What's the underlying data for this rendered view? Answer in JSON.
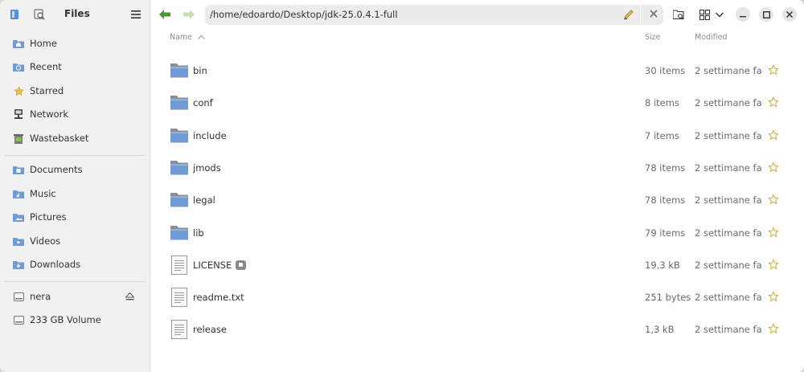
{
  "app": {
    "title": "Files"
  },
  "sidebar": {
    "places": [
      {
        "label": "Home",
        "icon": "home-folder-icon"
      },
      {
        "label": "Recent",
        "icon": "recent-folder-icon"
      },
      {
        "label": "Starred",
        "icon": "star-icon"
      },
      {
        "label": "Network",
        "icon": "network-icon"
      },
      {
        "label": "Wastebasket",
        "icon": "trash-icon"
      }
    ],
    "bookmarks": [
      {
        "label": "Documents",
        "icon": "documents-folder-icon"
      },
      {
        "label": "Music",
        "icon": "music-folder-icon"
      },
      {
        "label": "Pictures",
        "icon": "pictures-folder-icon"
      },
      {
        "label": "Videos",
        "icon": "videos-folder-icon"
      },
      {
        "label": "Downloads",
        "icon": "downloads-folder-icon"
      }
    ],
    "devices": [
      {
        "label": "nera",
        "icon": "drive-icon",
        "eject": true
      },
      {
        "label": "233 GB Volume",
        "icon": "drive-icon",
        "eject": false
      }
    ]
  },
  "location": {
    "path": "/home/edoardo/Desktop/jdk-25.0.4.1-full"
  },
  "columns": {
    "name": "Name",
    "size": "Size",
    "modified": "Modified"
  },
  "files": [
    {
      "name": "bin",
      "type": "folder",
      "size": "30 items",
      "modified": "2 settimane fa"
    },
    {
      "name": "conf",
      "type": "folder",
      "size": "8 items",
      "modified": "2 settimane fa"
    },
    {
      "name": "include",
      "type": "folder",
      "size": "7 items",
      "modified": "2 settimane fa"
    },
    {
      "name": "jmods",
      "type": "folder",
      "size": "78 items",
      "modified": "2 settimane fa"
    },
    {
      "name": "legal",
      "type": "folder",
      "size": "78 items",
      "modified": "2 settimane fa"
    },
    {
      "name": "lib",
      "type": "folder",
      "size": "79 items",
      "modified": "2 settimane fa"
    },
    {
      "name": "LICENSE",
      "type": "file",
      "locked": true,
      "size": "19,3 kB",
      "modified": "2 settimane fa"
    },
    {
      "name": "readme.txt",
      "type": "file",
      "size": "251 bytes",
      "modified": "2 settimane fa"
    },
    {
      "name": "release",
      "type": "file",
      "size": "1,3 kB",
      "modified": "2 settimane fa"
    }
  ],
  "colors": {
    "folder": "#6f9bd6",
    "star": "#e5c542",
    "back_arrow": "#4a9a3a"
  }
}
